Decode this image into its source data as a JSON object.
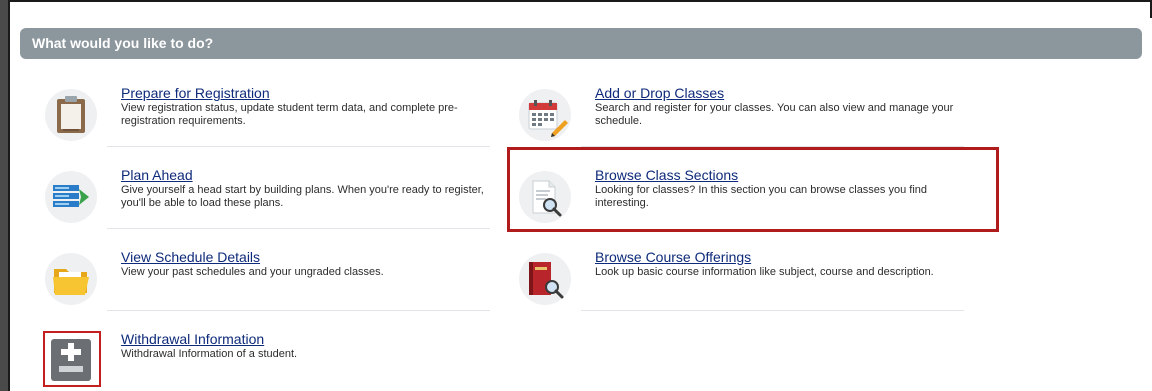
{
  "header": {
    "title": "What would you like to do?"
  },
  "items": [
    {
      "title": "Prepare for Registration",
      "desc": "View registration status, update student term data, and complete pre-registration requirements.",
      "icon": "clipboard-icon"
    },
    {
      "title": "Add or Drop Classes",
      "desc": "Search and register for your classes. You can also view and manage your schedule.",
      "icon": "calendar-edit-icon"
    },
    {
      "title": "Plan Ahead",
      "desc": "Give yourself a head start by building plans. When you're ready to register, you'll be able to load these plans.",
      "icon": "plan-list-icon"
    },
    {
      "title": "Browse Class Sections",
      "desc": "Looking for classes? In this section you can browse classes you find interesting.",
      "icon": "document-search-icon"
    },
    {
      "title": "View Schedule Details",
      "desc": "View your past schedules and your ungraded classes.",
      "icon": "folder-icon"
    },
    {
      "title": "Browse Course Offerings",
      "desc": "Look up basic course information like subject, course and description.",
      "icon": "book-search-icon"
    },
    {
      "title": "Withdrawal Information",
      "desc": "Withdrawal Information of a student.",
      "icon": "plus-minus-icon"
    }
  ],
  "colors": {
    "header_bg": "#8c969d",
    "link": "#0e2a7a",
    "highlight": "#b01c1c"
  }
}
